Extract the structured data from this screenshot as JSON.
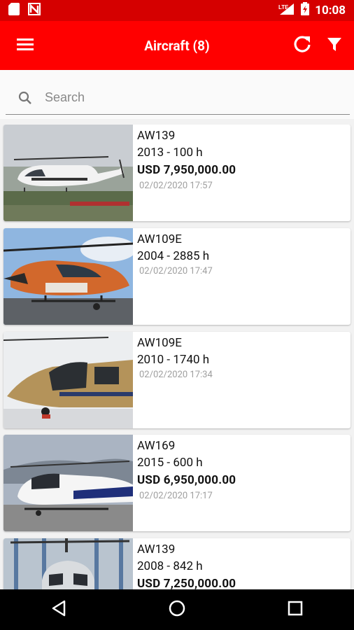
{
  "status": {
    "time": "10:08",
    "network": "LTE"
  },
  "appbar": {
    "title": "Aircraft (8)",
    "menu_icon": "menu-icon",
    "refresh_icon": "refresh-icon",
    "filter_icon": "filter-icon"
  },
  "search": {
    "placeholder": "Search",
    "value": ""
  },
  "aircraft": [
    {
      "model": "AW139",
      "year_hours": "2013 - 100 h",
      "price": "USD 7,950,000.00",
      "date": "02/02/2020 17:57"
    },
    {
      "model": "AW109E",
      "year_hours": "2004 - 2885 h",
      "price": "",
      "date": "02/02/2020 17:47"
    },
    {
      "model": "AW109E",
      "year_hours": "2010 - 1740 h",
      "price": "",
      "date": "02/02/2020 17:34"
    },
    {
      "model": "AW169",
      "year_hours": "2015 - 600 h",
      "price": "USD 6,950,000.00",
      "date": "02/02/2020 17:17"
    },
    {
      "model": "AW139",
      "year_hours": "2008 - 842 h",
      "price": "USD 7,250,000.00",
      "date": ""
    }
  ],
  "colors": {
    "primary": "#ff0000",
    "status": "#d50000"
  }
}
